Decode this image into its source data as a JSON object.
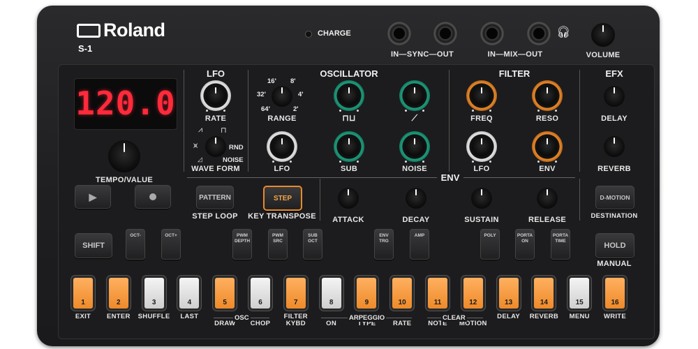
{
  "brand": "Roland",
  "model": "S-1",
  "charge_label": "CHARGE",
  "jacks": {
    "sync_label": "IN—SYNC—OUT",
    "mix_label": "IN—MIX—OUT"
  },
  "volume_label": "VOLUME",
  "display": {
    "value": "120.0",
    "color": "#ff2a3a"
  },
  "tempo_label": "TEMPO/VALUE",
  "sections": {
    "lfo": "LFO",
    "oscillator": "OSCILLATOR",
    "filter": "FILTER",
    "efx": "EFX",
    "env": "ENV"
  },
  "knobs": {
    "lfo_rate": "RATE",
    "range": "RANGE",
    "range_marks": [
      "16'",
      "8'",
      "32'",
      "4'",
      "64'",
      "2'"
    ],
    "wave_form": "WAVE FORM",
    "wave_rnd": "RND",
    "wave_noise": "NOISE",
    "osc_lfo": "LFO",
    "sub": "SUB",
    "noise": "NOISE",
    "freq": "FREQ",
    "reso": "RESO",
    "filter_lfo": "LFO",
    "filter_env": "ENV",
    "delay": "DELAY",
    "reverb": "REVERB",
    "attack": "ATTACK",
    "decay": "DECAY",
    "sustain": "SUSTAIN",
    "release": "RELEASE"
  },
  "buttons": {
    "pattern": "PATTERN",
    "step": "STEP",
    "step_loop": "STEP LOOP",
    "key_transpose": "KEY TRANSPOSE",
    "d_motion": "D-MOTION",
    "destination": "DESTINATION",
    "shift": "SHIFT",
    "oct_minus": "OCT-",
    "oct_plus": "OCT+",
    "pwm_depth": "PWM DEPTH",
    "pwm_src": "PWM SRC",
    "sub_oct": "SUB OCT",
    "env_trg": "ENV TRG",
    "amp": "AMP",
    "poly": "POLY",
    "porta_on": "PORTA ON",
    "porta_time": "PORTA TIME",
    "hold": "HOLD",
    "manual": "MANUAL",
    "play_icon": "play-icon",
    "rec_icon": "record-icon"
  },
  "pads": [
    {
      "num": "1",
      "label": "EXIT",
      "color": "orange"
    },
    {
      "num": "2",
      "label": "ENTER",
      "color": "orange"
    },
    {
      "num": "3",
      "label": "SHUFFLE",
      "color": "white"
    },
    {
      "num": "4",
      "label": "LAST",
      "color": "white"
    },
    {
      "num": "5",
      "label": "DRAW",
      "color": "orange"
    },
    {
      "num": "6",
      "label": "CHOP",
      "color": "white"
    },
    {
      "num": "7",
      "label": "FILTER KYBD",
      "color": "orange"
    },
    {
      "num": "8",
      "label": "ON",
      "color": "white"
    },
    {
      "num": "9",
      "label": "TYPE",
      "color": "orange"
    },
    {
      "num": "10",
      "label": "RATE",
      "color": "orange"
    },
    {
      "num": "11",
      "label": "NOTE",
      "color": "orange"
    },
    {
      "num": "12",
      "label": "MOTION",
      "color": "orange"
    },
    {
      "num": "13",
      "label": "DELAY",
      "color": "orange"
    },
    {
      "num": "14",
      "label": "REVERB",
      "color": "orange"
    },
    {
      "num": "15",
      "label": "MENU",
      "color": "white"
    },
    {
      "num": "16",
      "label": "WRITE",
      "color": "orange"
    }
  ],
  "group_labels": {
    "osc": "OSC",
    "arpeggio": "ARPEGGIO",
    "clear": "CLEAR"
  }
}
